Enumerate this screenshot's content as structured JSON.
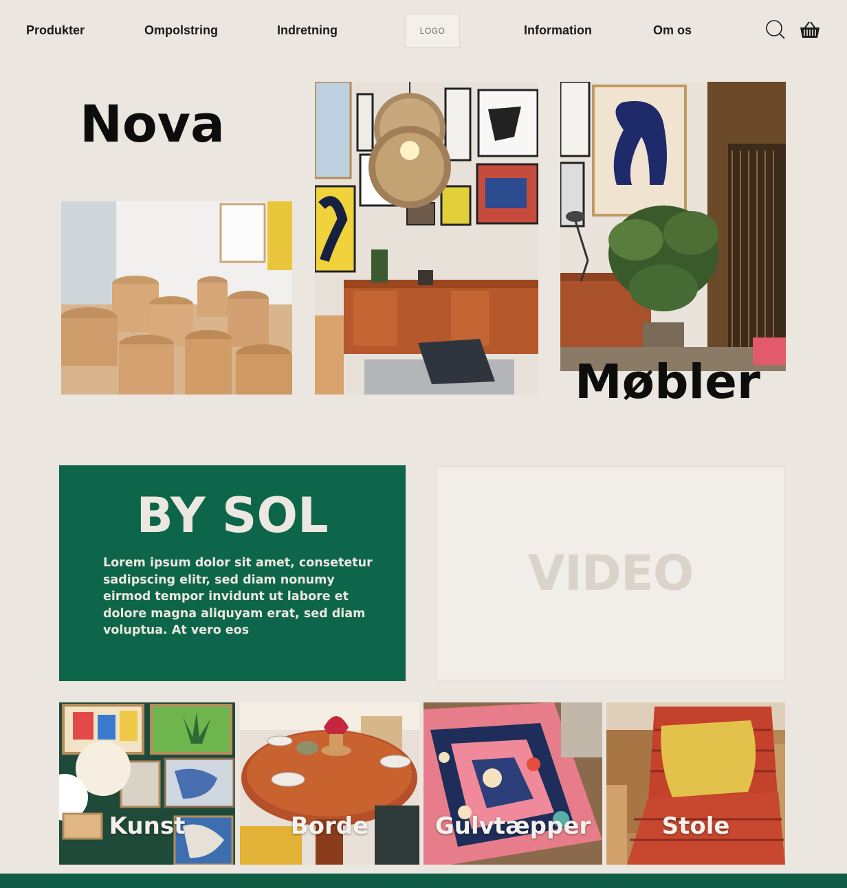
{
  "nav": {
    "items": [
      "Produkter",
      "Ompolstring",
      "Indretning",
      "Information",
      "Om os"
    ],
    "logo": "LOGO"
  },
  "hero": {
    "title_left": "Nova",
    "title_right": "Møbler"
  },
  "about": {
    "title": "BY SOL",
    "body": "Lorem ipsum dolor sit amet, consetetur sadipscing elitr, sed diam nonumy eirmod tempor invidunt ut labore et dolore magna aliquyam erat, sed diam voluptua. At vero eos"
  },
  "video": {
    "label": "VIDEO"
  },
  "categories": [
    "Kunst",
    "Borde",
    "Gulvtæpper",
    "Stole"
  ],
  "icons": {
    "search": "search-icon",
    "cart": "basket-icon"
  },
  "colors": {
    "background": "#ebe6df",
    "brand_green": "#0d6649",
    "footer_green": "#0d5c43"
  }
}
